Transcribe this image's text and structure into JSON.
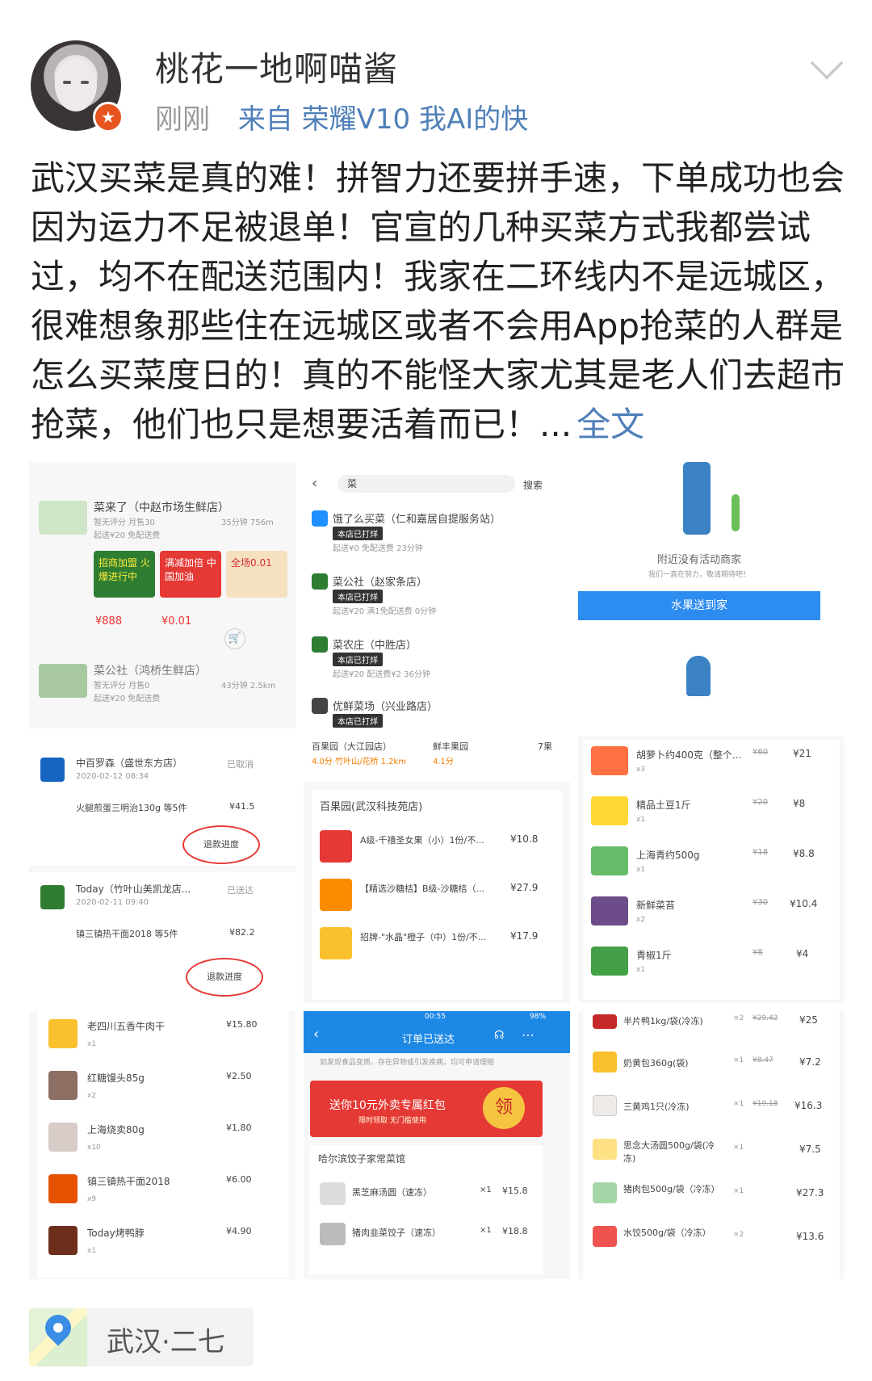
{
  "user": {
    "name": "桃花一地啊喵酱",
    "time": "刚刚",
    "source": "来自 荣耀V10 我AI的快"
  },
  "post": {
    "text": "武汉买菜是真的难！拼智力还要拼手速，下单成功也会因为运力不足被退单！官宣的几种买菜方式我都尝试过，均不在配送范围内！我家在二环线内不是远城区，很难想象那些住在远城区或者不会用App抢菜的人群是怎么买菜度日的！真的不能怪大家尤其是老人们去超市抢菜，他们也只是想要活着而已！...",
    "more": "全文"
  },
  "location": "武汉·二七",
  "images": {
    "c1": {
      "shop1": "菜来了（中赵市场生鲜店）",
      "shop1_sub": "暂无评分  月售30",
      "shop1_dist": "35分钟 756m",
      "shop1_fee": "起送¥20  免配送费",
      "promo1": "招商加盟 火爆进行中",
      "promo2": "满减加倍 中国加油",
      "promo3": "全场0.01",
      "price1": "¥888",
      "price2": "¥0.01",
      "shop2": "菜公社（鸿桥生鲜店）",
      "shop2_sub": "暂无评分  月售0",
      "shop2_dist": "43分钟 2.5km",
      "shop2_fee": "起送¥20  免配送费"
    },
    "c2": {
      "search": "菜",
      "search_btn": "搜索",
      "store1": "饿了么买菜（仁和嘉居自提服务站）",
      "store1_fee": "起送¥0  免配送费  23分钟",
      "store2": "菜公社（赵家条店）",
      "store2_fee": "起送¥20  满1免配送费  0分钟",
      "store3": "菜农庄（中胜店）",
      "store3_fee": "起送¥20  配送费¥2  36分钟",
      "store4": "优鲜菜场（兴业路店）",
      "closed": "本店已打烊"
    },
    "c3": {
      "empty": "附近没有活动商家",
      "empty_sub": "我们一直在努力，敬请期待吧！",
      "button": "水果送到家"
    },
    "c4": {
      "o1_store": "中百罗森（盛世东方店）",
      "o1_status": "已取消",
      "o1_time": "2020-02-12 08:34",
      "o1_items": "火腿煎蛋三明治130g 等5件",
      "o1_price": "¥41.5",
      "refund": "退款进度",
      "o2_store": "Today（竹叶山美凯龙店...",
      "o2_status": "已送达",
      "o2_time": "2020-02-11 09:40",
      "o2_items": "镇三镇热干面2018 等5件",
      "o2_price": "¥82.2"
    },
    "c5": {
      "top1": "百果园（大江园店）",
      "top2": "鲜丰果园",
      "top3": "7果",
      "rating1": "4.0分 竹叶山/花桥 1.2km",
      "rating2": "4.1分",
      "store": "百果园(武汉科技苑店)",
      "items": [
        {
          "name": "A级-千禧圣女果（小）1份/不...",
          "price": "¥10.8"
        },
        {
          "name": "【精选沙糖桔】B级-沙糖桔（...",
          "price": "¥27.9"
        },
        {
          "name": "招牌-\"水晶\"橙子（中）1份/不...",
          "price": "¥17.9"
        }
      ]
    },
    "c6": {
      "items": [
        {
          "name": "胡萝卜约400克（整个...",
          "old": "¥60",
          "price": "¥21",
          "qty": "x3"
        },
        {
          "name": "精品土豆1斤",
          "old": "¥20",
          "price": "¥8",
          "qty": "x1"
        },
        {
          "name": "上海青约500g",
          "old": "¥18",
          "price": "¥8.8",
          "qty": "x1"
        },
        {
          "name": "新鲜菜苔",
          "old": "¥30",
          "price": "¥10.4",
          "qty": "x2"
        },
        {
          "name": "青椒1斤",
          "old": "¥8",
          "price": "¥4",
          "qty": "x1"
        }
      ]
    },
    "c7": {
      "items": [
        {
          "name": "老四川五香牛肉干",
          "price": "¥15.80",
          "qty": "x1"
        },
        {
          "name": "红糖馒头85g",
          "price": "¥2.50",
          "qty": "x2"
        },
        {
          "name": "上海烧卖80g",
          "price": "¥1.80",
          "qty": "x10"
        },
        {
          "name": "镇三镇热干面2018",
          "price": "¥6.00",
          "qty": "x9"
        },
        {
          "name": "Today烤鸭脖",
          "price": "¥4.90",
          "qty": "x1"
        }
      ]
    },
    "c8": {
      "status_time": "00:55",
      "status_batt": "98%",
      "title": "订单已送达",
      "notice": "如发现食品变质、存在异物或引发疾病，均可申请理赔",
      "banner": "送你10元外卖专属红包",
      "banner_sub": "限时领取 无门槛使用",
      "banner_btn": "领",
      "store": "哈尔滨饺子家常菜馆",
      "items": [
        {
          "name": "黑芝麻汤圆（速冻）",
          "qty": "×1",
          "price": "¥15.8"
        },
        {
          "name": "猪肉韭菜饺子（速冻）",
          "qty": "×1",
          "price": "¥18.8"
        }
      ]
    },
    "c9": {
      "items": [
        {
          "name": "半片鸭1kg/袋(冷冻)",
          "qty": "×2",
          "old": "¥29.42",
          "price": "¥25"
        },
        {
          "name": "奶黄包360g(袋)",
          "qty": "×1",
          "old": "¥8.47",
          "price": "¥7.2"
        },
        {
          "name": "三黄鸡1只(冷冻)",
          "qty": "×1",
          "old": "¥19.18",
          "price": "¥16.3"
        },
        {
          "name": "思念大汤圆500g/袋(冷冻)",
          "qty": "×1",
          "old": "",
          "price": "¥7.5"
        },
        {
          "name": "猪肉包500g/袋（冷冻）",
          "qty": "×1",
          "old": "",
          "price": "¥27.3"
        },
        {
          "name": "水饺500g/袋（冷冻）",
          "qty": "×2",
          "old": "",
          "price": "¥13.6"
        }
      ]
    }
  }
}
